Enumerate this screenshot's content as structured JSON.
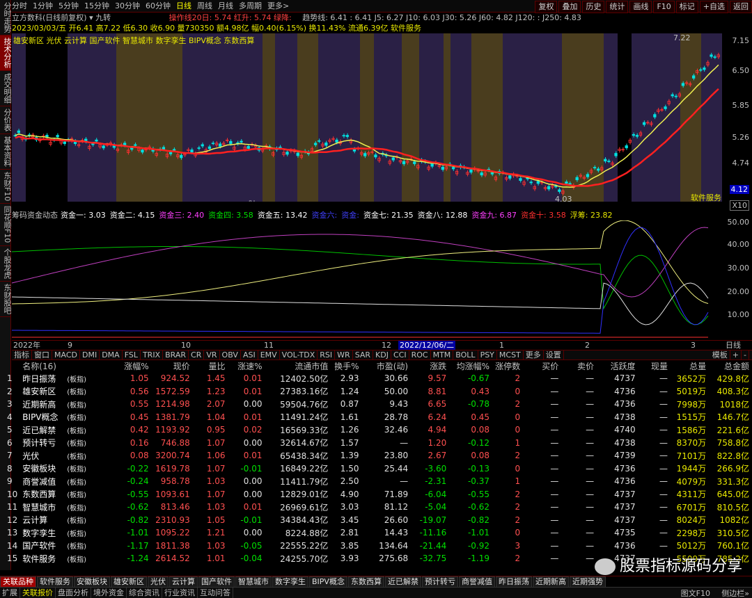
{
  "leftbar": {
    "items": [
      "分时走势",
      "技术分析",
      "成交明细",
      "分价表",
      "基本资料",
      "东财F10",
      "同花顺F10",
      "个股龙虎",
      "东财股吧"
    ]
  },
  "periods": [
    "分时",
    "1分钟",
    "5分钟",
    "15分钟",
    "30分钟",
    "60分钟",
    "日线",
    "周线",
    "月线",
    "多周期",
    "更多>"
  ],
  "active_period": "日线",
  "rbtns": [
    "复权",
    "叠加",
    "历史",
    "统计",
    "画线",
    "F10",
    "标记",
    "+自选",
    "返回"
  ],
  "info": {
    "title": "立方数科(日线前复权)",
    "indicator": "九转",
    "ma_line": "操作线20日: 5.74 红升: 5.74 绿降: ",
    "trend_line": "趋势线: 6.41  : 6.41  J5: 6.27  J10: 6.03  J30: 5.26  J60: 4.82  J120: : J250: 4.83",
    "ohlc": "2023/03/03/五 开6.41 高7.22 低6.30 收6.90 量730350 额4.98亿 幅0.40(6.15%) 换11.43% 流通6.39亿 软件服务",
    "concepts": "雄安新区 光伏 云计算 国产软件 智慧城市 数字孪生 BIPV概念 东数西算"
  },
  "kaxis": [
    "7.15",
    "6.50",
    "5.85",
    "5.26",
    "4.74"
  ],
  "kaxis_tag": "4.12",
  "kaxis_unit": "X10",
  "kchart_labels": {
    "high": "7.22",
    "low": "4.03",
    "sector": "软件服务",
    "ev1": "财",
    "ev2": "预",
    "ev3": "榜",
    "ev4": "减"
  },
  "ind": {
    "name": "筹码资金动态",
    "items": [
      {
        "label": "资金一: 3.03",
        "color": "#ffffff"
      },
      {
        "label": "资金二: 4.15",
        "color": "#ffffff"
      },
      {
        "label": "资金三: 2.40",
        "color": "#ff40ff"
      },
      {
        "label": "资金四: 3.58",
        "color": "#00e000"
      },
      {
        "label": "资金五: 13.42",
        "color": "#ffffff"
      },
      {
        "label": "资金六:",
        "color": "#4040ff"
      },
      {
        "label": "资金:",
        "color": "#4040ff"
      },
      {
        "label": "资金七: 21.35",
        "color": "#ffffff"
      },
      {
        "label": "资金八: 12.88",
        "color": "#ffffff"
      },
      {
        "label": "资金九: 6.87",
        "color": "#ff40ff"
      },
      {
        "label": "资金十: 3.58",
        "color": "#ff3030"
      },
      {
        "label": "浮筹: 23.82",
        "color": "#e8e800"
      }
    ]
  },
  "indaxis": [
    "50.00",
    "40.00",
    "30.00",
    "20.00",
    "10.00"
  ],
  "dates": {
    "y": "2022年",
    "m9": "9",
    "m10": "10",
    "m11": "11",
    "m12": "12",
    "sel": "2022/12/06/二",
    "m1": "1",
    "m2": "2",
    "m3": "3",
    "period": "日线"
  },
  "indtabs": [
    "指标",
    "窗口",
    "MACD",
    "DMI",
    "DMA",
    "FSL",
    "TRIX",
    "BRAR",
    "CR",
    "VR",
    "OBV",
    "ASI",
    "EMV",
    "VOL-TDX",
    "RSI",
    "WR",
    "SAR",
    "KDJ",
    "CCI",
    "ROC",
    "MTM",
    "BOLL",
    "PSY",
    "MCST",
    "更多",
    "设置"
  ],
  "indtabs_right": [
    "模板",
    "+",
    "-"
  ],
  "table": {
    "headers": [
      "",
      "名称(16)",
      "",
      "涨幅%",
      "现价",
      "量比",
      "涨速%",
      "流通市值",
      "换手%",
      "市盈(动)",
      "涨跌",
      "均涨幅%",
      "涨停数",
      "买价",
      "卖价",
      "活跃度",
      "现量",
      "总量",
      "总金额"
    ],
    "rows": [
      [
        "1",
        "昨日振荡",
        "(板指)",
        "1.05",
        "924.52",
        "1.45",
        "0.01",
        "12402.50亿",
        "2.93",
        "30.66",
        "9.57",
        "-0.67",
        "2",
        "—",
        "—",
        "4737",
        "—",
        "3652万",
        "429.8亿"
      ],
      [
        "2",
        "雄安新区",
        "(板指)",
        "0.56",
        "1572.59",
        "1.23",
        "0.01",
        "27383.16亿",
        "1.24",
        "50.00",
        "8.81",
        "0.43",
        "0",
        "—",
        "—",
        "4736",
        "—",
        "5019万",
        "408.3亿"
      ],
      [
        "3",
        "近期新高",
        "(板指)",
        "0.55",
        "1214.98",
        "2.07",
        "0.00",
        "59504.76亿",
        "0.87",
        "9.43",
        "6.65",
        "-0.78",
        "2",
        "—",
        "—",
        "4736",
        "—",
        "7998万",
        "1018亿"
      ],
      [
        "4",
        "BIPV概念",
        "(板指)",
        "0.45",
        "1381.79",
        "1.04",
        "0.01",
        "11491.24亿",
        "1.61",
        "28.78",
        "6.24",
        "0.45",
        "0",
        "—",
        "—",
        "4738",
        "—",
        "1515万",
        "146.7亿"
      ],
      [
        "5",
        "近已解禁",
        "(板指)",
        "0.42",
        "1193.92",
        "0.95",
        "0.02",
        "16569.33亿",
        "1.26",
        "32.46",
        "4.94",
        "0.08",
        "0",
        "—",
        "—",
        "4740",
        "—",
        "1586万",
        "221.6亿"
      ],
      [
        "6",
        "预计转亏",
        "(板指)",
        "0.16",
        "746.88",
        "1.07",
        "0.00",
        "32614.67亿",
        "1.57",
        "—",
        "1.20",
        "-0.12",
        "1",
        "—",
        "—",
        "4738",
        "—",
        "8370万",
        "758.8亿"
      ],
      [
        "7",
        "光伏",
        "(板指)",
        "0.08",
        "3200.74",
        "1.06",
        "0.01",
        "65438.34亿",
        "1.39",
        "23.80",
        "2.67",
        "0.08",
        "2",
        "—",
        "—",
        "4739",
        "—",
        "7101万",
        "822.8亿"
      ],
      [
        "8",
        "安徽板块",
        "(板指)",
        "-0.22",
        "1619.78",
        "1.07",
        "-0.01",
        "16849.22亿",
        "1.50",
        "25.44",
        "-3.60",
        "-0.13",
        "0",
        "—",
        "—",
        "4736",
        "—",
        "1944万",
        "266.9亿"
      ],
      [
        "9",
        "商誉减值",
        "(板指)",
        "-0.24",
        "958.78",
        "1.03",
        "0.00",
        "11411.79亿",
        "2.50",
        "—",
        "-2.31",
        "-0.37",
        "1",
        "—",
        "—",
        "4736",
        "—",
        "4079万",
        "331.3亿"
      ],
      [
        "10",
        "东数西算",
        "(板指)",
        "-0.55",
        "1093.61",
        "1.07",
        "0.00",
        "12829.01亿",
        "4.90",
        "71.89",
        "-6.04",
        "-0.55",
        "2",
        "—",
        "—",
        "4737",
        "—",
        "4311万",
        "645.0亿"
      ],
      [
        "11",
        "智慧城市",
        "(板指)",
        "-0.62",
        "813.46",
        "1.03",
        "0.01",
        "26969.61亿",
        "3.03",
        "81.12",
        "-5.04",
        "-0.62",
        "2",
        "—",
        "—",
        "4737",
        "—",
        "6701万",
        "810.5亿"
      ],
      [
        "12",
        "云计算",
        "(板指)",
        "-0.82",
        "2310.93",
        "1.05",
        "-0.01",
        "34384.43亿",
        "3.45",
        "26.60",
        "-19.07",
        "-0.82",
        "2",
        "—",
        "—",
        "4737",
        "—",
        "8024万",
        "1082亿"
      ],
      [
        "13",
        "数字孪生",
        "(板指)",
        "-1.01",
        "1095.22",
        "1.21",
        "0.00",
        "8224.88亿",
        "2.81",
        "14.43",
        "-11.16",
        "-1.01",
        "0",
        "—",
        "—",
        "4735",
        "—",
        "2298万",
        "310.5亿"
      ],
      [
        "14",
        "国产软件",
        "(板指)",
        "-1.17",
        "1811.38",
        "1.03",
        "-0.05",
        "22555.22亿",
        "3.85",
        "134.64",
        "-21.44",
        "-0.92",
        "3",
        "—",
        "—",
        "4736",
        "—",
        "5012万",
        "760.1亿"
      ],
      [
        "15",
        "软件服务",
        "(板指)",
        "-1.24",
        "2614.52",
        "1.01",
        "-0.04",
        "24255.70亿",
        "3.93",
        "275.68",
        "-32.75",
        "-1.19",
        "2",
        "—",
        "—",
        "4737",
        "—",
        "5509万",
        "785.2亿"
      ]
    ]
  },
  "sectabs": [
    "关联品种",
    "软件服务",
    "安徽板块",
    "雄安新区",
    "光伏",
    "云计算",
    "国产软件",
    "智慧城市",
    "数字孪生",
    "BIPV概念",
    "东数西算",
    "近已解禁",
    "预计转亏",
    "商誉减值",
    "昨日振荡",
    "近期新高",
    "近期强势"
  ],
  "bottom": [
    "扩展",
    "关联报价",
    "盘面分析",
    "境外资金",
    "综合资讯",
    "行业资讯",
    "互动问答"
  ],
  "bottom_right": "图文F10",
  "bottom_right2": "侧边栏»",
  "watermark": "股票指标源码分享"
}
